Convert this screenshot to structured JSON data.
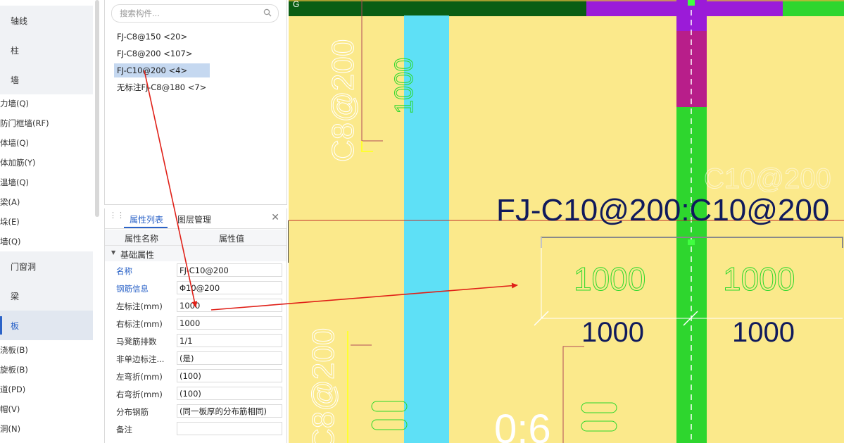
{
  "nav": {
    "items": [
      {
        "label": "轴线",
        "kind": "category"
      },
      {
        "label": "柱",
        "kind": "category"
      },
      {
        "label": "墙",
        "kind": "category"
      },
      {
        "label": "力墙(Q)",
        "kind": "item"
      },
      {
        "label": "防门框墙(RF)",
        "kind": "item"
      },
      {
        "label": "体墙(Q)",
        "kind": "item"
      },
      {
        "label": "体加筋(Y)",
        "kind": "item"
      },
      {
        "label": "温墙(Q)",
        "kind": "item"
      },
      {
        "label": "梁(A)",
        "kind": "item"
      },
      {
        "label": "垛(E)",
        "kind": "item"
      },
      {
        "label": "墙(Q)",
        "kind": "item"
      },
      {
        "label": "门窗洞",
        "kind": "category"
      },
      {
        "label": "梁",
        "kind": "category"
      },
      {
        "label": "板",
        "kind": "category-selected"
      },
      {
        "label": "浇板(B)",
        "kind": "item"
      },
      {
        "label": "旋板(B)",
        "kind": "item"
      },
      {
        "label": "道(PD)",
        "kind": "item"
      },
      {
        "label": "帽(V)",
        "kind": "item"
      },
      {
        "label": "洞(N)",
        "kind": "item"
      }
    ]
  },
  "component_list": {
    "search_placeholder": "搜索构件...",
    "items": [
      {
        "label": "FJ-C8@150 <20>",
        "selected": false
      },
      {
        "label": "FJ-C8@200 <107>",
        "selected": false
      },
      {
        "label": "FJ-C10@200 <4>",
        "selected": true
      },
      {
        "label": "无标注FJ-C8@180 <7>",
        "selected": false
      }
    ]
  },
  "properties": {
    "tabs": [
      "属性列表",
      "图层管理"
    ],
    "active_tab": "属性列表",
    "col_name": "属性名称",
    "col_value": "属性值",
    "group": "基础属性",
    "rows": [
      {
        "name": "名称",
        "value": "FJ-C10@200",
        "highlight": true
      },
      {
        "name": "钢筋信息",
        "value": "Φ10@200",
        "highlight": true
      },
      {
        "name": "左标注(mm)",
        "value": "1000",
        "highlight": false
      },
      {
        "name": "右标注(mm)",
        "value": "1000",
        "highlight": false
      },
      {
        "name": "马凳筋排数",
        "value": "1/1",
        "highlight": false
      },
      {
        "name": "非单边标注...",
        "value": "(是)",
        "highlight": false
      },
      {
        "name": "左弯折(mm)",
        "value": "(100)",
        "highlight": false
      },
      {
        "name": "右弯折(mm)",
        "value": "(100)",
        "highlight": false
      },
      {
        "name": "分布钢筋",
        "value": "(同一板厚的分布筋相同)",
        "highlight": false
      },
      {
        "name": "备注",
        "value": "",
        "highlight": false
      }
    ]
  },
  "canvas": {
    "corner_label": "G",
    "main_annotation": "FJ-C10@200:C10@200",
    "left_label": "1000",
    "right_label": "1000",
    "left_dim_green": "1000",
    "right_dim_green": "1000",
    "upper_rebar_text": "C8@200",
    "upper_rebar_dim": "1000",
    "upper_right_ghost": "C10@200",
    "lower_rebar_text": "C8@200",
    "bottom_text": "0:6"
  },
  "colors": {
    "accent": "#2b63c8",
    "slab_yellow": "#fbe98b",
    "beam_cyan": "#5ee0f6",
    "wall_green": "#2ed62e",
    "wall_purple": "#9e1e9e",
    "annotation_navy": "#101a5c",
    "leader_red": "#e02018"
  }
}
